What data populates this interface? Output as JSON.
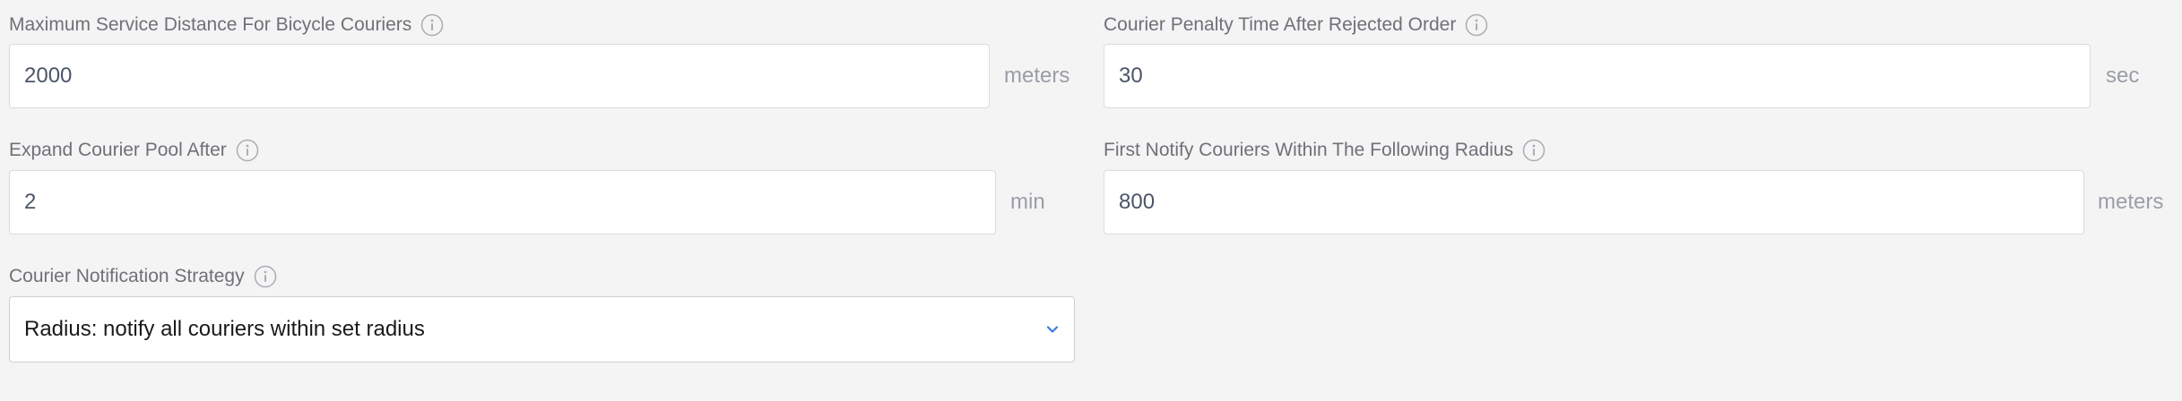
{
  "fields": {
    "bicycle_distance": {
      "label": "Maximum Service Distance For Bicycle Couriers",
      "value": "2000",
      "unit": "meters"
    },
    "penalty_time": {
      "label": "Courier Penalty Time After Rejected Order",
      "value": "30",
      "unit": "sec"
    },
    "expand_pool": {
      "label": "Expand Courier Pool After",
      "value": "2",
      "unit": "min"
    },
    "notify_radius": {
      "label": "First Notify Couriers Within The Following Radius",
      "value": "800",
      "unit": "meters"
    },
    "notification_strategy": {
      "label": "Courier Notification Strategy",
      "selected": "Radius: notify all couriers within set radius"
    }
  },
  "icons": {
    "info": "info-circle-icon",
    "dropdown": "chevron-down-icon"
  },
  "colors": {
    "accent": "#3b7ddd",
    "background": "#f4f4f4"
  }
}
